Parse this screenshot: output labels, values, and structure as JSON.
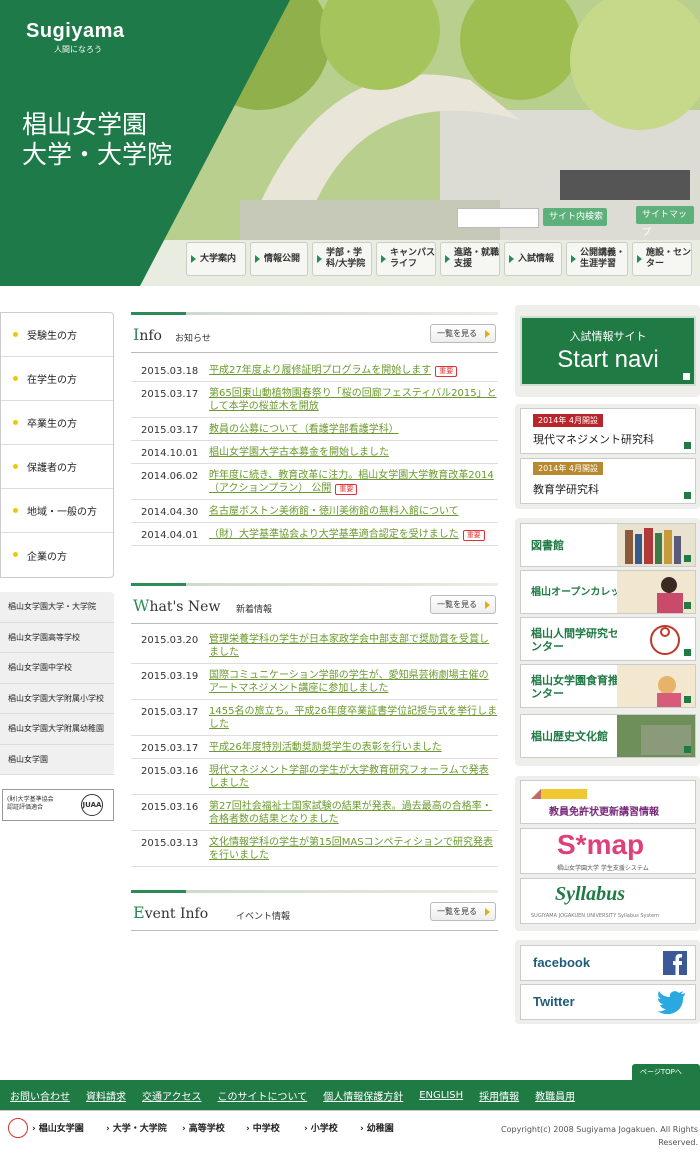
{
  "header": {
    "logo": {
      "name": "Sugiyama",
      "tagline": "人間になろう"
    },
    "title_line1": "椙山女学園",
    "title_line2": "大学・大学院",
    "search_button": "サイト内検索",
    "sitemap_button": "サイトマップ",
    "gnav": [
      "大学案内",
      "情報公開",
      "学部・学科/大学院",
      "キャンパスライフ",
      "進路・就職支援",
      "入試情報",
      "公開講義・生涯学習",
      "施設・センター"
    ]
  },
  "left_nav": {
    "audience": [
      "受験生の方",
      "在学生の方",
      "卒業生の方",
      "保護者の方",
      "地域・一般の方",
      "企業の方"
    ],
    "schools": [
      "椙山女学園大学・大学院",
      "椙山女学園高等学校",
      "椙山女学園中学校",
      "椙山女学園大学附属小学校",
      "椙山女学園大学附属幼稚園",
      "椙山女学園"
    ],
    "accreditation_line1": "(財)大学基準協会",
    "accreditation_line2": "認証評価適合"
  },
  "info": {
    "title_first": "I",
    "title_rest": "nfo",
    "subtitle": "お知らせ",
    "more": "一覧を見る",
    "badge": "重要",
    "items": [
      {
        "date": "2015.03.18",
        "title": "平成27年度より履修証明プログラムを開始します",
        "important": true
      },
      {
        "date": "2015.03.17",
        "title": "第65回東山動植物園春祭り「桜の回廊フェスティバル2015」として本学の桜並木を開放",
        "important": false
      },
      {
        "date": "2015.03.17",
        "title": "教員の公募について（看護学部看護学科）",
        "important": false
      },
      {
        "date": "2014.10.01",
        "title": "椙山女学園大学古本募金を開始しました",
        "important": false
      },
      {
        "date": "2014.06.02",
        "title": "昨年度に続き、教育改革に注力。椙山女学園大学教育改革2014（アクションプラン） 公開",
        "important": true
      },
      {
        "date": "2014.04.30",
        "title": "名古屋ボストン美術館・徳川美術館の無料入館について",
        "important": false
      },
      {
        "date": "2014.04.01",
        "title": "（財）大学基準協会より大学基準適合認定を受けました",
        "important": true
      }
    ]
  },
  "whatsnew": {
    "title_first": "W",
    "title_rest": "hat's New",
    "subtitle": "新着情報",
    "more": "一覧を見る",
    "items": [
      {
        "date": "2015.03.20",
        "title": "管理栄養学科の学生が日本家政学会中部支部で奨励賞を受賞しました"
      },
      {
        "date": "2015.03.19",
        "title": "国際コミュニケーション学部の学生が、愛知県芸術劇場主催のアートマネジメント講座に参加しました"
      },
      {
        "date": "2015.03.17",
        "title": "1455名の旅立ち。平成26年度卒業証書学位記授与式を挙行しました"
      },
      {
        "date": "2015.03.17",
        "title": "平成26年度特別活動奨励奨学生の表彰を行いました"
      },
      {
        "date": "2015.03.16",
        "title": "現代マネジメント学部の学生が大学教育研究フォーラムで発表しました"
      },
      {
        "date": "2015.03.16",
        "title": "第27回社会福祉士国家試験の結果が発表。過去最高の合格率・合格者数の結果となりました"
      },
      {
        "date": "2015.03.13",
        "title": "文化情報学科の学生が第15回MASコンペティションで研究発表を行いました"
      }
    ]
  },
  "event": {
    "title_first": "E",
    "title_rest": "vent Info",
    "subtitle": "イベント情報",
    "more": "一覧を見る"
  },
  "right": {
    "startnavi_small": "入試情報サイト",
    "startnavi_big": "Start navi",
    "labs": [
      {
        "tag": "2014年 4月開設",
        "name": "現代マネジメント研究科",
        "tag_color": "#b8262b"
      },
      {
        "tag": "2014年 4月開設",
        "name": "教育学研究科",
        "tag_color": "#b8892e"
      }
    ],
    "facilities": [
      "図書館",
      "椙山オープンカレッジ",
      "椙山人間学研究センター",
      "椙山女学園食育推進センター",
      "椙山歴史文化館"
    ],
    "banners": {
      "license": "教員免許状更新講習情報",
      "smap": "S*map",
      "smap_sub": "椙山女学園大学 学生支援システム",
      "syllabus": "Syllabus",
      "syllabus_sub": "SUGIYAMA JOGAKUEN UNIVERSITY Syllabus System"
    },
    "sns": [
      "facebook",
      "Twitter"
    ]
  },
  "footer": {
    "pagetop": "ページTOPへ",
    "links": [
      "お問い合わせ",
      "資料請求",
      "交通アクセス",
      "このサイトについて",
      "個人情報保護方針",
      "ENGLISH",
      "採用情報",
      "教職員用"
    ],
    "schools": [
      "椙山女学園",
      "大学・大学院",
      "高等学校",
      "中学校",
      "小学校",
      "幼稚園"
    ],
    "copyright_line1": "Copyright(c) 2008 Sugiyama Jogakuen. All Rights",
    "copyright_line2": "Reserved."
  },
  "colors": {
    "brand_green": "#1f7a44",
    "link_green": "#6b9a2f",
    "important_red": "#d33333",
    "bullet_yellow": "#f0c800"
  }
}
